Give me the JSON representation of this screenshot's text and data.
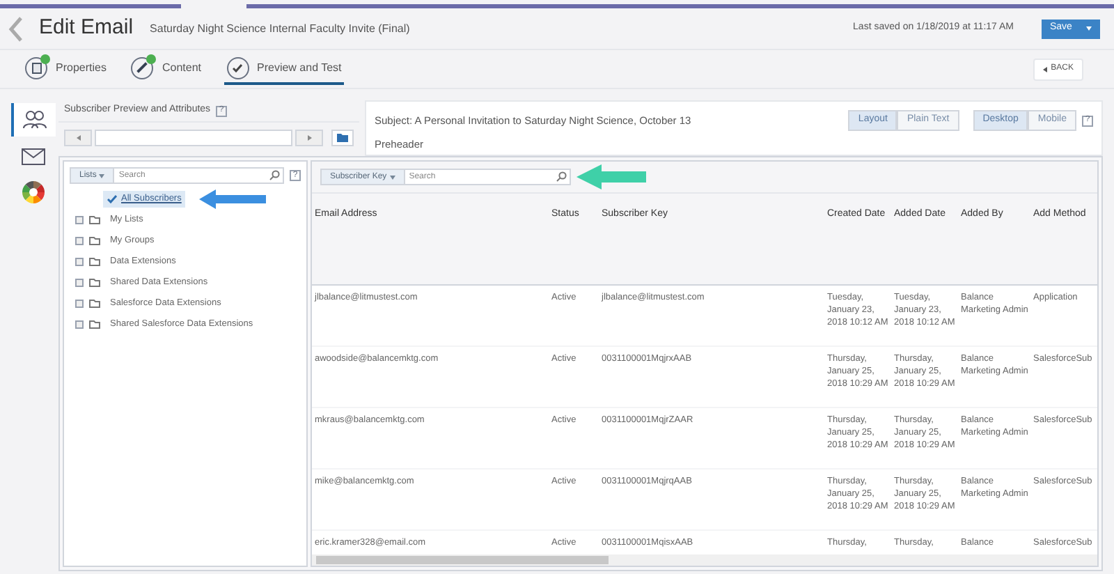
{
  "header": {
    "title": "Edit Email",
    "subtitle": "Saturday Night Science Internal Faculty Invite (Final)",
    "last_saved": "Last saved on 1/18/2019 at 11:17 AM",
    "save_button": "Save"
  },
  "tabs": [
    {
      "label": "Properties",
      "kind": "properties",
      "completed": true,
      "selected": false
    },
    {
      "label": "Content",
      "kind": "content",
      "completed": true,
      "selected": false
    },
    {
      "label": "Preview and Test",
      "kind": "preview",
      "completed": false,
      "selected": true
    }
  ],
  "back_button": "BACK",
  "sidebar_icons": [
    {
      "kind": "subscribers",
      "selected": true
    },
    {
      "kind": "email",
      "selected": false
    },
    {
      "kind": "color-wheel",
      "selected": false
    }
  ],
  "left_panel": {
    "title": "Subscriber Preview and Attributes",
    "help": "?"
  },
  "preview": {
    "subject": "Subject: A Personal Invitation to Saturday Night Science, October 13",
    "preheader": "Preheader",
    "view_toggle": [
      {
        "label": "Layout",
        "selected": true
      },
      {
        "label": "Plain Text",
        "selected": false
      }
    ],
    "device_toggle": [
      {
        "label": "Desktop",
        "selected": true
      },
      {
        "label": "Mobile",
        "selected": false
      }
    ],
    "help": "?"
  },
  "lists_panel": {
    "filter": "Lists",
    "search_placeholder": "Search",
    "help": "?",
    "items": [
      {
        "label": "All Subscribers",
        "kind": "all",
        "selected": true
      },
      {
        "label": "My Lists",
        "kind": "folder",
        "selected": false
      },
      {
        "label": "My Groups",
        "kind": "folder",
        "selected": false
      },
      {
        "label": "Data Extensions",
        "kind": "folder",
        "selected": false
      },
      {
        "label": "Shared Data Extensions",
        "kind": "folder",
        "selected": false
      },
      {
        "label": "Salesforce Data Extensions",
        "kind": "folder",
        "selected": false
      },
      {
        "label": "Shared Salesforce Data Extensions",
        "kind": "folder",
        "selected": false
      }
    ]
  },
  "table": {
    "filter": "Subscriber Key",
    "search_placeholder": "Search",
    "columns": [
      "Email Address",
      "Status",
      "Subscriber Key",
      "Created Date",
      "Added Date",
      "Added By",
      "Add Method"
    ],
    "rows": [
      [
        "jlbalance@litmustest.com",
        "Active",
        "jlbalance@litmustest.com",
        "Tuesday, January 23, 2018 10:12 AM",
        "Tuesday, January 23, 2018 10:12 AM",
        "Balance Marketing Admin",
        "Application"
      ],
      [
        "awoodside@balancemktg.com",
        "Active",
        "0031100001MqjrxAAB",
        "Thursday, January 25, 2018 10:29 AM",
        "Thursday, January 25, 2018 10:29 AM",
        "Balance Marketing Admin",
        "SalesforceSub"
      ],
      [
        "mkraus@balancemktg.com",
        "Active",
        "0031100001MqjrZAAR",
        "Thursday, January 25, 2018 10:29 AM",
        "Thursday, January 25, 2018 10:29 AM",
        "Balance Marketing Admin",
        "SalesforceSub"
      ],
      [
        "mike@balancemktg.com",
        "Active",
        "0031100001MqjrqAAB",
        "Thursday, January 25, 2018 10:29 AM",
        "Thursday, January 25, 2018 10:29 AM",
        "Balance Marketing Admin",
        "SalesforceSub"
      ],
      [
        "eric.kramer328@email.com",
        "Active",
        "0031100001MqisxAAB",
        "Thursday,",
        "Thursday,",
        "Balance",
        "SalesforceSub"
      ]
    ]
  }
}
